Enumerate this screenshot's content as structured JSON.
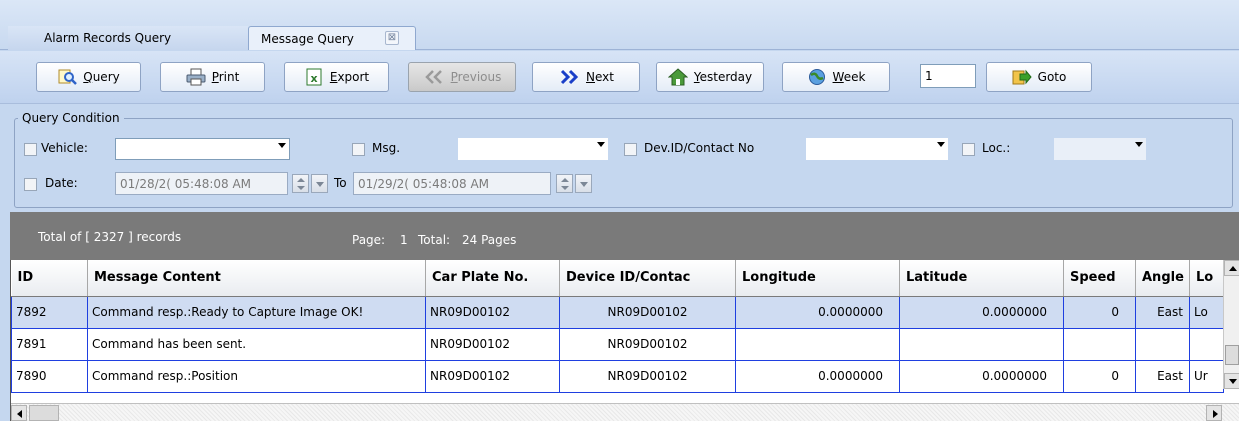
{
  "tabs": [
    {
      "label": "Alarm Records Query",
      "active": false
    },
    {
      "label": "Message Query",
      "active": true,
      "close_glyph": "⊠"
    }
  ],
  "toolbar": {
    "query_label": "Query",
    "print_label": "Print",
    "export_label": "Export",
    "previous_label": "Previous",
    "next_label": "Next",
    "yesterday_label": "Yesterday",
    "week_label": "Week",
    "page_value": "1",
    "goto_label": "Goto"
  },
  "query": {
    "legend": "Query Condition",
    "vehicle_label": "Vehicle:",
    "vehicle_value": "",
    "msg_label": "Msg.",
    "msg_value": "",
    "devid_label": "Dev.ID/Contact No",
    "devid_value": "",
    "loc_label": "Loc.:",
    "loc_value": "",
    "date_label": "Date:",
    "date_from": "01/28/2( 05:48:08 AM",
    "to_label": "To",
    "date_to": "01/29/2( 05:48:08 AM"
  },
  "records": {
    "total_text": "Total of [ 2327 ] records",
    "page_label": "Page:",
    "page_value": "1",
    "total_label": "Total:",
    "total_pages": "24 Pages"
  },
  "grid": {
    "columns": [
      "ID",
      "Message Content",
      "Car Plate No.",
      "Device ID/Contac",
      "Longitude",
      "Latitude",
      "Speed",
      "Angle",
      "Lo"
    ],
    "rows": [
      [
        "7892",
        "Command resp.:Ready to Capture Image OK!",
        "NR09D00102",
        "NR09D00102",
        "0.0000000",
        "0.0000000",
        "0",
        "East",
        "Lo"
      ],
      [
        "7891",
        "Command has been sent.",
        "NR09D00102",
        "NR09D00102",
        "",
        "",
        "",
        "",
        ""
      ],
      [
        "7890",
        "Command resp.:Position",
        "NR09D00102",
        "NR09D00102",
        "0.0000000",
        "0.0000000",
        "0",
        "East",
        "Ur"
      ]
    ]
  },
  "colors": {
    "background": "#c5d7ef",
    "records_bar": "#7a7a7a",
    "grid_line": "#1f3fe0",
    "selected_row": "#cfdcf2"
  },
  "icons": {
    "query": "magnifier-icon",
    "print": "printer-icon",
    "export": "excel-export-icon",
    "previous": "double-left-arrow-icon",
    "next": "double-right-arrow-icon",
    "yesterday": "home-arrow-icon",
    "week": "globe-icon",
    "goto": "goto-arrow-icon"
  }
}
